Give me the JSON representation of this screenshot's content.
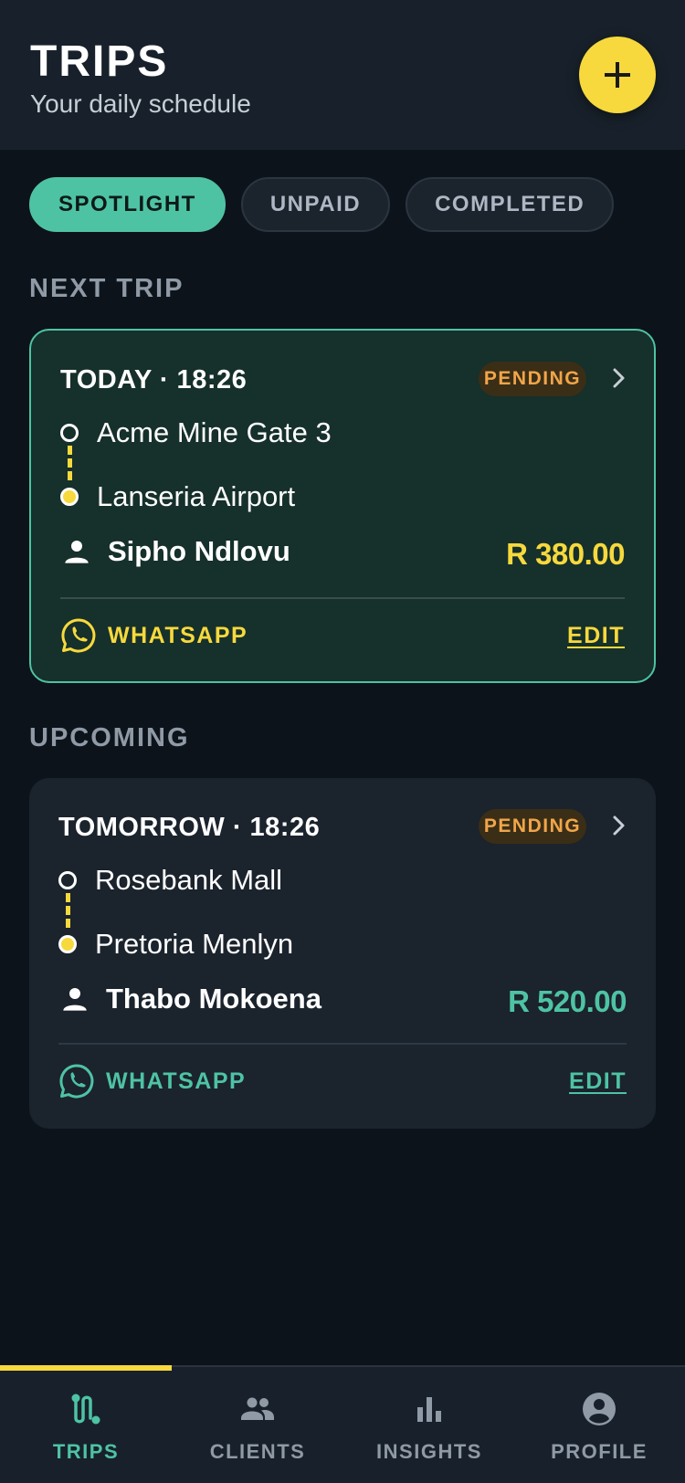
{
  "header": {
    "title": "TRIPS",
    "subtitle": "Your daily schedule",
    "add_icon": "plus-icon"
  },
  "filters": [
    {
      "label": "SPOTLIGHT",
      "active": true
    },
    {
      "label": "UNPAID",
      "active": false
    },
    {
      "label": "COMPLETED",
      "active": false
    }
  ],
  "next_section": {
    "label": "NEXT TRIP"
  },
  "upcoming_section": {
    "label": "UPCOMING"
  },
  "trips": [
    {
      "when": "TODAY · 18:26",
      "status": "PENDING",
      "origin": "Acme Mine Gate 3",
      "destination": "Lanseria Airport",
      "client": "Sipho Ndlovu",
      "price": "R 380.00",
      "whatsapp_label": "WHATSAPP",
      "edit_label": "EDIT",
      "accent": "#f7d93d"
    },
    {
      "when": "TOMORROW · 18:26",
      "status": "PENDING",
      "origin": "Rosebank Mall",
      "destination": "Pretoria Menlyn",
      "client": "Thabo Mokoena",
      "price": "R 520.00",
      "whatsapp_label": "WHATSAPP",
      "edit_label": "EDIT",
      "accent": "#4ec3a4"
    }
  ],
  "nav": [
    {
      "label": "TRIPS",
      "icon": "route-icon",
      "active": true
    },
    {
      "label": "CLIENTS",
      "icon": "people-icon",
      "active": false
    },
    {
      "label": "INSIGHTS",
      "icon": "bar-chart-icon",
      "active": false
    },
    {
      "label": "PROFILE",
      "icon": "account-circle-icon",
      "active": false
    }
  ],
  "colors": {
    "background": "#0d131a",
    "surface": "#18212b",
    "accent_teal": "#4ec3a4",
    "accent_yellow": "#f7d93d",
    "pending_text": "#f0a64a"
  }
}
